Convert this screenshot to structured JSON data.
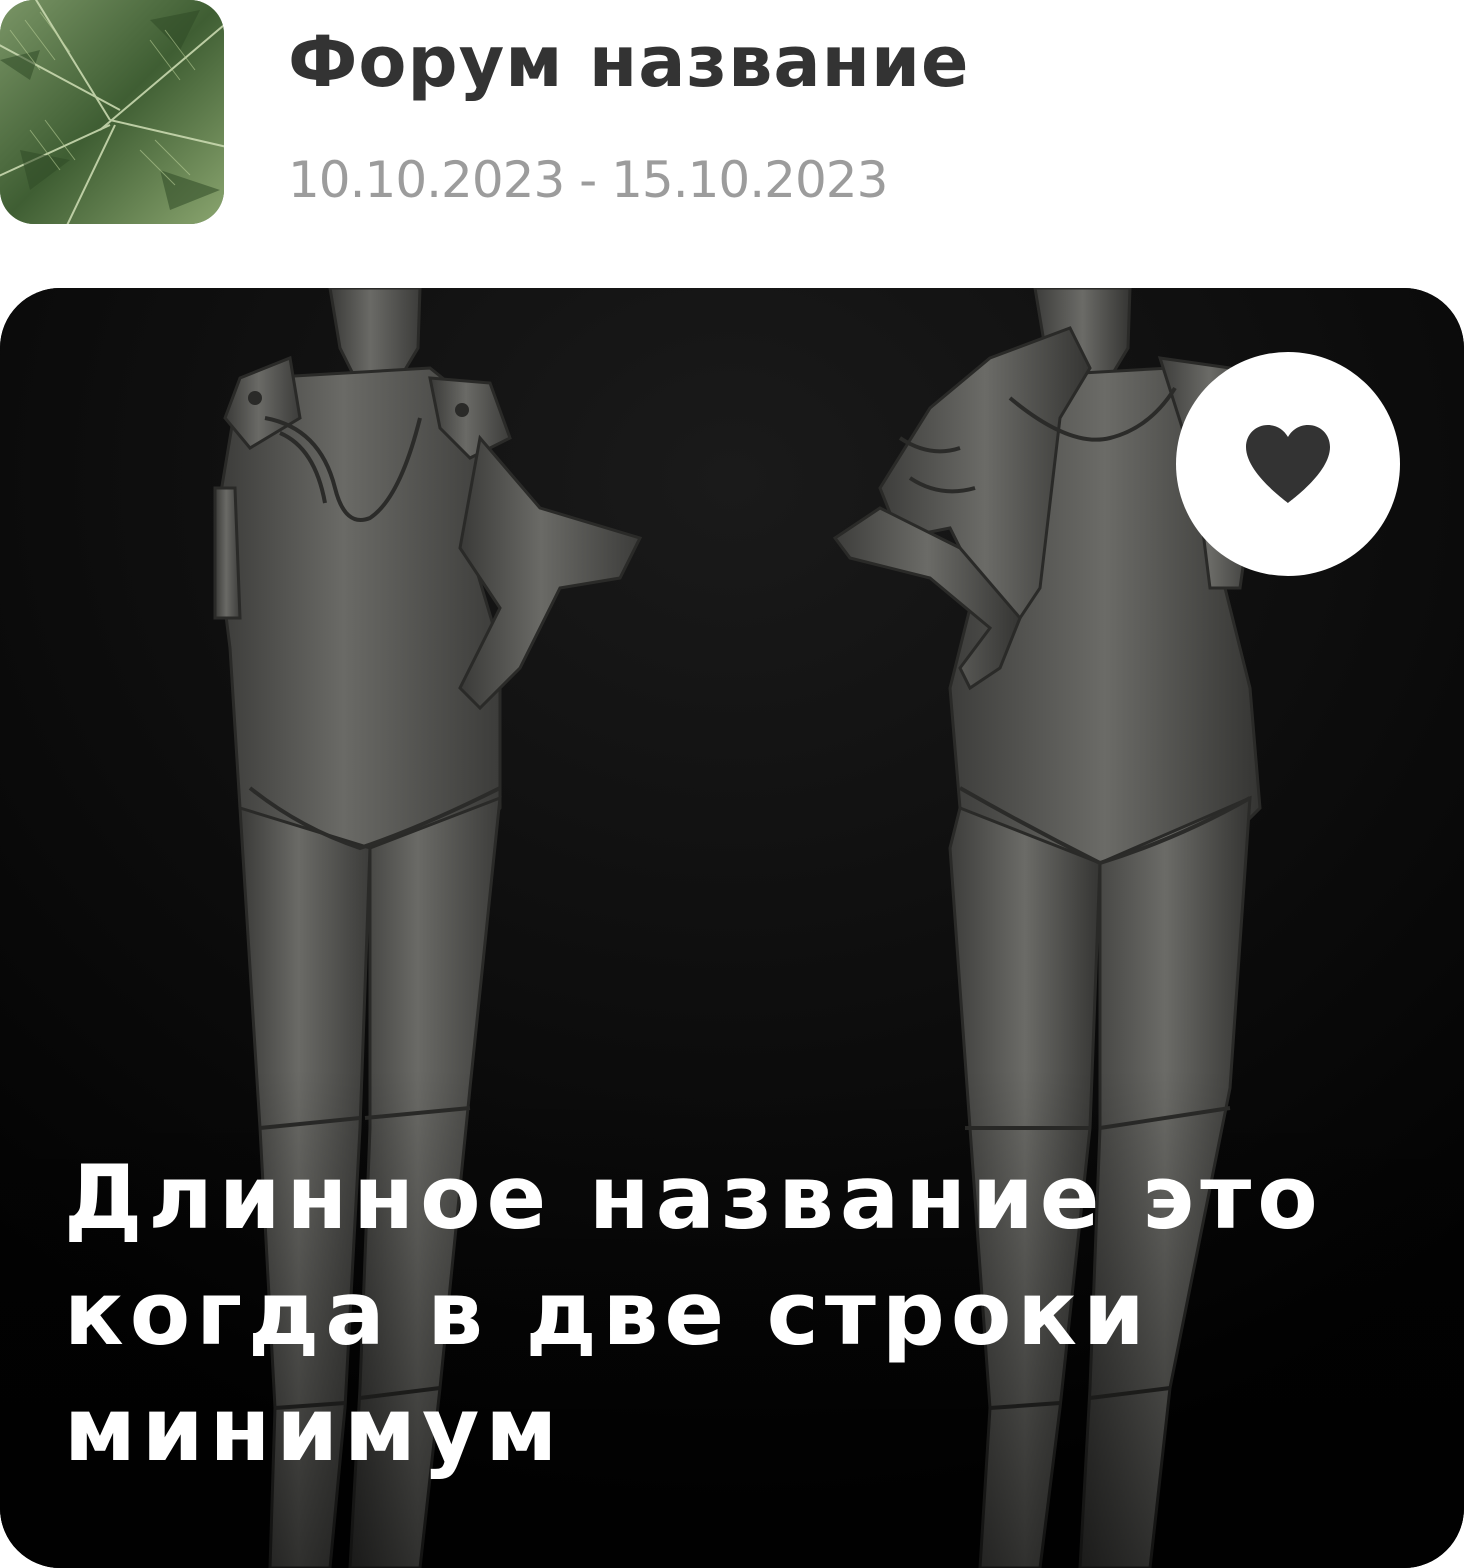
{
  "forum": {
    "title": "Форум название",
    "dates": "10.10.2023 - 15.10.2023",
    "avatar_icon": "palm-leaves-image"
  },
  "post": {
    "title": "Длинное название это когда в две строки минимум",
    "image": "two-3d-female-figure-sculpts",
    "like_icon": "heart-icon"
  },
  "colors": {
    "title_text": "#333333",
    "date_text": "#9c9c9c",
    "card_background": "#050505",
    "like_button_bg": "#ffffff",
    "heart": "#333333",
    "post_title_text": "#ffffff"
  }
}
